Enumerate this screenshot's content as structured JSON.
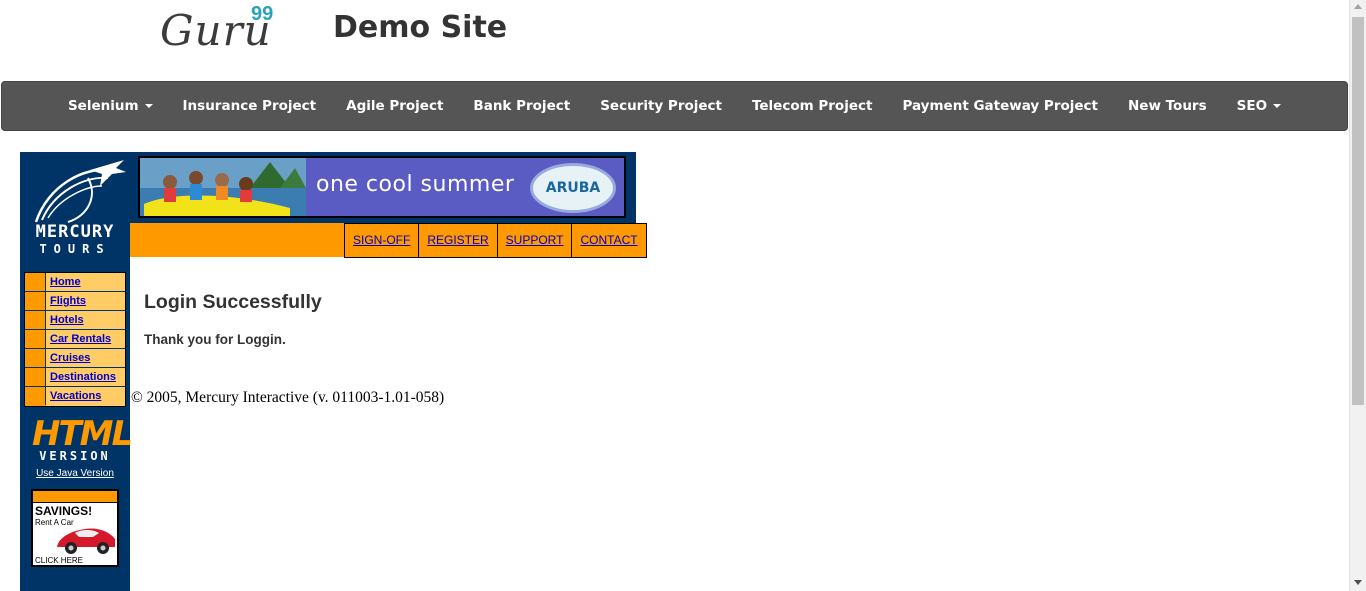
{
  "header": {
    "logo_text": "Guru",
    "logo_number": "99",
    "site_title": "Demo Site"
  },
  "nav": {
    "items": [
      {
        "label": "Selenium",
        "dropdown": true
      },
      {
        "label": "Insurance Project",
        "dropdown": false
      },
      {
        "label": "Agile Project",
        "dropdown": false
      },
      {
        "label": "Bank Project",
        "dropdown": false
      },
      {
        "label": "Security Project",
        "dropdown": false
      },
      {
        "label": "Telecom Project",
        "dropdown": false
      },
      {
        "label": "Payment Gateway Project",
        "dropdown": false
      },
      {
        "label": "New Tours",
        "dropdown": false
      },
      {
        "label": "SEO",
        "dropdown": true
      }
    ]
  },
  "mercury": {
    "brand_line1": "MERCURY",
    "brand_line2": "TOURS",
    "menu": [
      "Home",
      "Flights",
      "Hotels",
      "Car Rentals",
      "Cruises",
      "Destinations",
      "Vacations"
    ],
    "html_badge": "HTML",
    "version_word": "VERSION",
    "java_link": "Use Java Version",
    "savings": {
      "title": "SAVINGS!",
      "subtitle": "Rent A Car",
      "cta": "CLICK HERE"
    }
  },
  "banner": {
    "text": "one cool summer",
    "brand": "ARUBA"
  },
  "top_links": [
    "SIGN-OFF",
    "REGISTER",
    "SUPPORT",
    "CONTACT"
  ],
  "main": {
    "heading": "Login Successfully",
    "message": "Thank you for Loggin."
  },
  "footer": {
    "copyright": "© 2005, Mercury Interactive (v. 011003-1.01-058)"
  },
  "colors": {
    "navbar": "#555555",
    "mercury_blue": "#003366",
    "mercury_orange": "#ff9900",
    "menu_cell": "#ffcc66",
    "link_blue": "#0000cc",
    "logo_accent": "#2aa3b8"
  }
}
